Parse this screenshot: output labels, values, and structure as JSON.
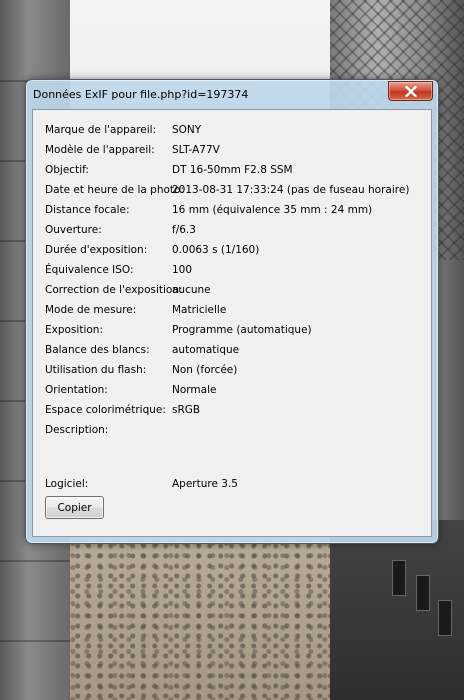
{
  "window": {
    "title": "Données ExIF pour file.php?id=197374",
    "close_icon": "close-icon"
  },
  "exif": {
    "rows": [
      {
        "label": "Marque de l'appareil:",
        "value": "SONY"
      },
      {
        "label": "Modèle de l'appareil:",
        "value": "SLT-A77V"
      },
      {
        "label": "Objectif:",
        "value": "DT 16-50mm F2.8 SSM"
      },
      {
        "label": "Date et heure de la photo:",
        "value": "2013-08-31 17:33:24 (pas de fuseau horaire)"
      },
      {
        "label": "Distance focale:",
        "value": "16 mm (équivalence 35 mm : 24 mm)"
      },
      {
        "label": "Ouverture:",
        "value": "f/6.3"
      },
      {
        "label": "Durée d'exposition:",
        "value": "0.0063 s (1/160)"
      },
      {
        "label": "Équivalence ISO:",
        "value": "100"
      },
      {
        "label": "Correction de l'exposition:",
        "value": "aucune"
      },
      {
        "label": "Mode de mesure:",
        "value": "Matricielle"
      },
      {
        "label": "Exposition:",
        "value": "Programme (automatique)"
      },
      {
        "label": "Balance des blancs:",
        "value": "automatique"
      },
      {
        "label": "Utilisation du flash:",
        "value": "Non (forcée)"
      },
      {
        "label": "Orientation:",
        "value": "Normale"
      },
      {
        "label": "Espace colorimétrique:",
        "value": "sRGB"
      },
      {
        "label": "Description:",
        "value": ""
      }
    ],
    "software": {
      "label": "Logiciel:",
      "value": "Aperture 3.5"
    }
  },
  "buttons": {
    "copy_label": "Copier"
  }
}
